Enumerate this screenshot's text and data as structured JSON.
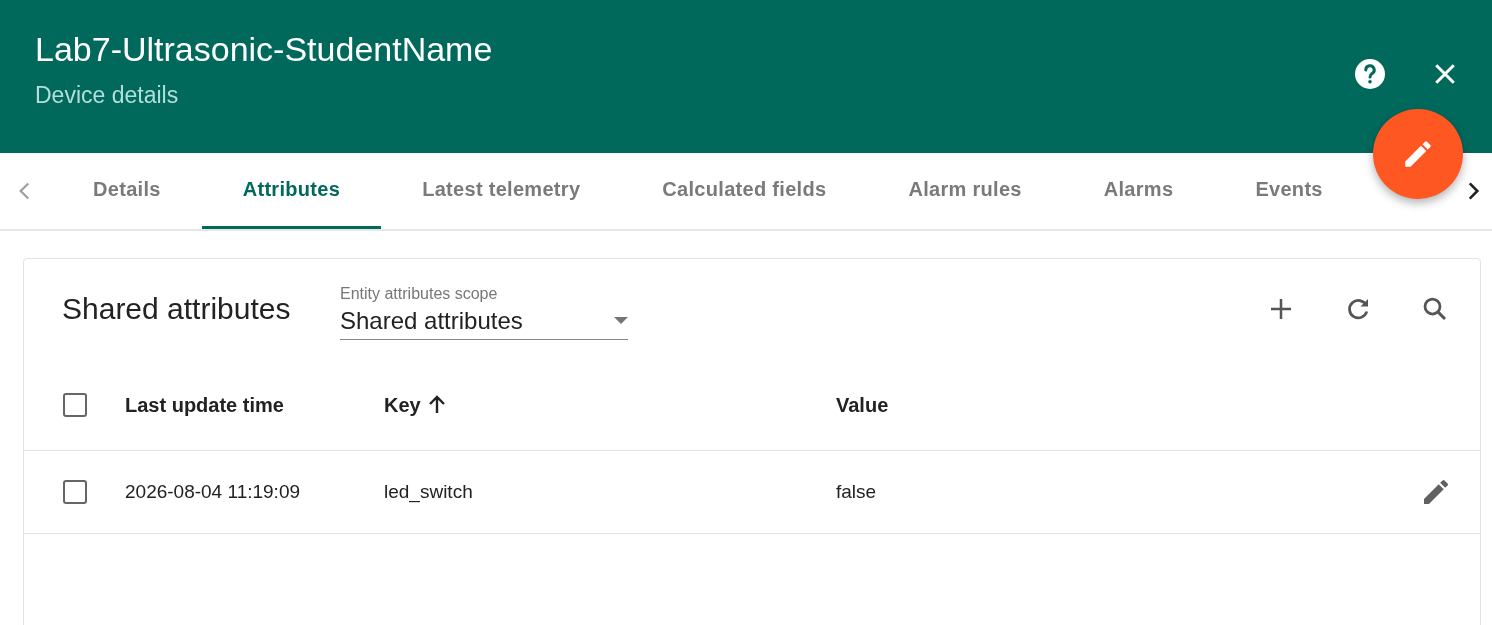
{
  "header": {
    "title": "Lab7-Ultrasonic-StudentName",
    "subtitle": "Device details"
  },
  "tabs": [
    {
      "label": "Details",
      "selected": false
    },
    {
      "label": "Attributes",
      "selected": true
    },
    {
      "label": "Latest telemetry",
      "selected": false
    },
    {
      "label": "Calculated fields",
      "selected": false
    },
    {
      "label": "Alarm rules",
      "selected": false
    },
    {
      "label": "Alarms",
      "selected": false
    },
    {
      "label": "Events",
      "selected": false
    }
  ],
  "panel": {
    "title": "Shared attributes",
    "scope": {
      "label": "Entity attributes scope",
      "value": "Shared attributes"
    }
  },
  "table": {
    "columns": [
      {
        "label": "Last update time",
        "sorted": false
      },
      {
        "label": "Key",
        "sorted": true
      },
      {
        "label": "Value",
        "sorted": false
      }
    ],
    "header_checked": false,
    "rows": [
      {
        "checked": false,
        "cells": [
          "2026-08-04 11:19:09",
          "led_switch",
          "false"
        ]
      }
    ]
  }
}
